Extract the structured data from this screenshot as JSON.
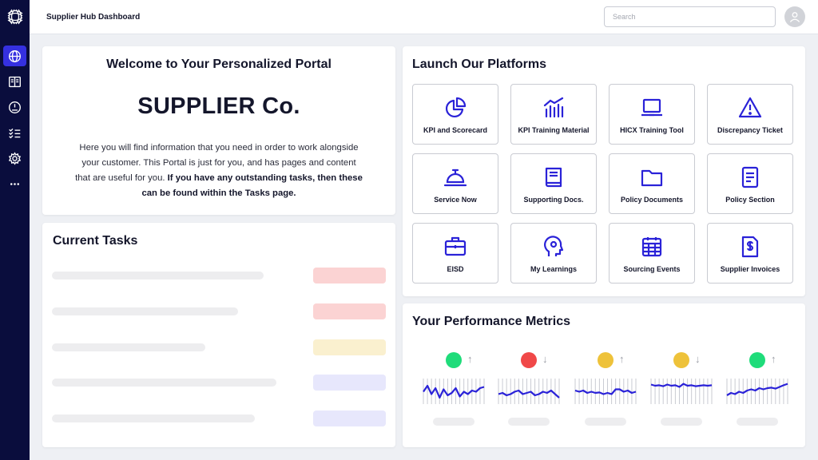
{
  "header": {
    "title": "Supplier Hub Dashboard",
    "search_placeholder": "Search"
  },
  "sidebar": {
    "items": [
      {
        "icon": "globe-icon",
        "active": true
      },
      {
        "icon": "book-icon",
        "active": false
      },
      {
        "icon": "gauge-icon",
        "active": false
      },
      {
        "icon": "checklist-icon",
        "active": false
      },
      {
        "icon": "gear-icon",
        "active": false
      },
      {
        "icon": "more-icon",
        "active": false
      }
    ]
  },
  "welcome": {
    "title": "Welcome to Your Personalized Portal",
    "company": "SUPPLIER Co.",
    "text": "Here you will find information that you need in order to work alongside your customer. This Portal is just for you, and has pages and content that are useful for you.",
    "text_bold": "If you have any outstanding tasks, then these can be found within the Tasks page."
  },
  "tasks": {
    "title": "Current Tasks",
    "pill_colors": [
      "#fbd3d3",
      "#fbd3d3",
      "#faf0cf",
      "#e7e7fc",
      "#e7e7fc"
    ]
  },
  "platforms": {
    "title": "Launch Our Platforms",
    "tiles": [
      {
        "label": "KPI and Scorecard",
        "icon": "pie-chart-icon"
      },
      {
        "label": "KPI Training Material",
        "icon": "bar-chart-icon"
      },
      {
        "label": "HICX Training Tool",
        "icon": "laptop-icon"
      },
      {
        "label": "Discrepancy Ticket",
        "icon": "warning-icon"
      },
      {
        "label": "Service Now",
        "icon": "service-bell-icon"
      },
      {
        "label": "Supporting Docs.",
        "icon": "book-icon"
      },
      {
        "label": "Policy Documents",
        "icon": "folder-icon"
      },
      {
        "label": "Policy Section",
        "icon": "document-icon"
      },
      {
        "label": "EISD",
        "icon": "briefcase-icon"
      },
      {
        "label": "My Learnings",
        "icon": "head-gear-icon"
      },
      {
        "label": "Sourcing Events",
        "icon": "calendar-icon"
      },
      {
        "label": "Supplier Invoices",
        "icon": "invoice-icon"
      }
    ]
  },
  "metrics": {
    "title": "Your Performance Metrics",
    "items": [
      {
        "status_color": "#1fdc7a",
        "trend": "up",
        "arrow": "↑",
        "series": [
          0.45,
          0.7,
          0.35,
          0.6,
          0.2,
          0.55,
          0.3,
          0.4,
          0.6,
          0.25,
          0.45,
          0.35,
          0.5,
          0.45,
          0.6,
          0.65
        ]
      },
      {
        "status_color": "#f04848",
        "trend": "down",
        "arrow": "↓",
        "series": [
          0.35,
          0.4,
          0.3,
          0.35,
          0.45,
          0.5,
          0.35,
          0.4,
          0.45,
          0.3,
          0.35,
          0.45,
          0.4,
          0.5,
          0.35,
          0.2
        ]
      },
      {
        "status_color": "#eec23a",
        "trend": "up",
        "arrow": "↑",
        "series": [
          0.5,
          0.45,
          0.5,
          0.4,
          0.45,
          0.4,
          0.42,
          0.35,
          0.4,
          0.35,
          0.55,
          0.55,
          0.45,
          0.5,
          0.4,
          0.45
        ]
      },
      {
        "status_color": "#eec23a",
        "trend": "down",
        "arrow": "↓",
        "series": [
          0.75,
          0.7,
          0.72,
          0.68,
          0.75,
          0.7,
          0.72,
          0.65,
          0.78,
          0.7,
          0.72,
          0.68,
          0.7,
          0.72,
          0.7,
          0.72
        ]
      },
      {
        "status_color": "#1fdc7a",
        "trend": "up",
        "arrow": "↑",
        "series": [
          0.3,
          0.4,
          0.35,
          0.45,
          0.4,
          0.5,
          0.55,
          0.5,
          0.6,
          0.55,
          0.6,
          0.62,
          0.58,
          0.65,
          0.72,
          0.78
        ]
      }
    ]
  },
  "colors": {
    "accent": "#3530e0",
    "sidebar": "#0a0d3d",
    "spark_line": "#2a22d8"
  }
}
